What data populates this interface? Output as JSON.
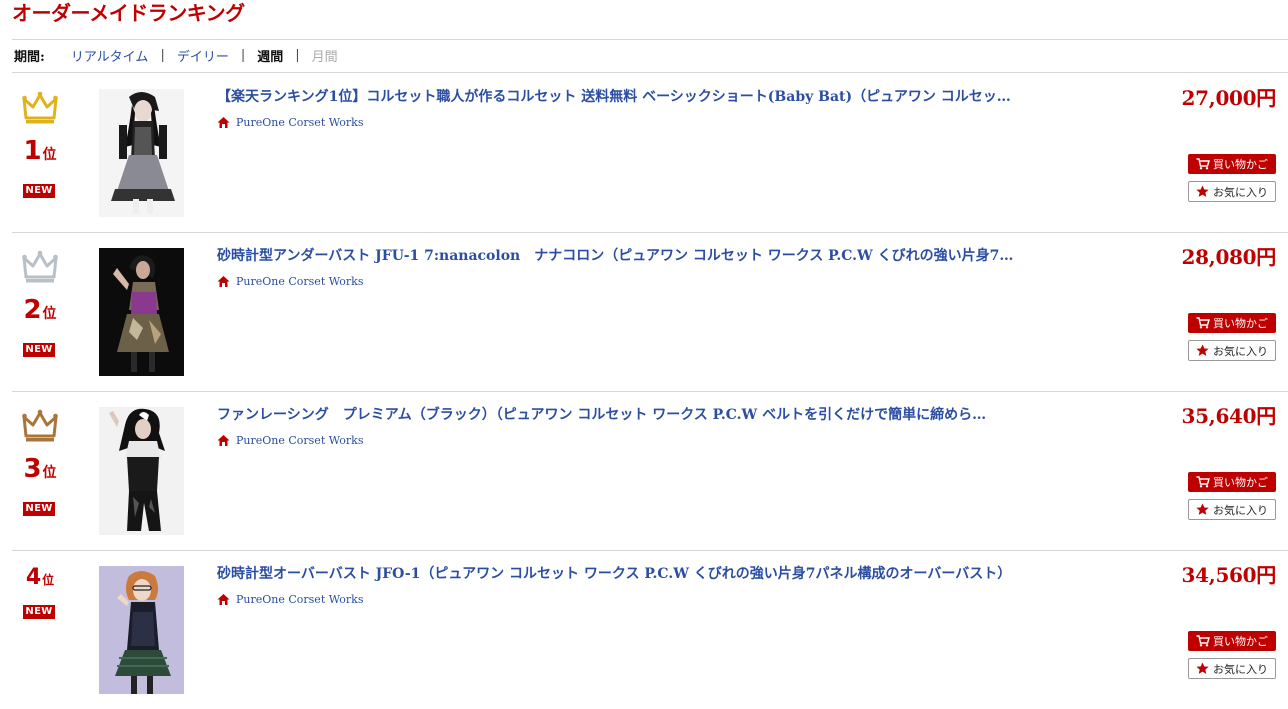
{
  "title": "オーダーメイドランキング",
  "period": {
    "label": "期間:",
    "options": [
      {
        "label": "リアルタイム",
        "state": "link"
      },
      {
        "label": "デイリー",
        "state": "link"
      },
      {
        "label": "週間",
        "state": "active"
      },
      {
        "label": "月間",
        "state": "disabled"
      }
    ],
    "separator": "|"
  },
  "colors": {
    "accent": "#bf0000",
    "link": "#2b4ea2",
    "crown_gold": "#e0b21e",
    "crown_silver": "#b7bfc7",
    "crown_bronze": "#a8753a"
  },
  "labels": {
    "new": "NEW",
    "rank_suffix": "位",
    "cart": "買い物かご",
    "favorite": "お気に入り"
  },
  "icons": {
    "shop": "house-icon",
    "cart": "cart-icon",
    "favorite": "star-icon",
    "rank": "crown-icon"
  },
  "items": [
    {
      "rank": "1",
      "crown": "gold",
      "name": "【楽天ランキング1位】コルセット職人が作るコルセット 送料無料 ベーシックショート(Baby Bat)（ピュアワン コルセッ…",
      "shop": "PureOne Corset Works",
      "price": "27,000円"
    },
    {
      "rank": "2",
      "crown": "silver",
      "name": "砂時計型アンダーバスト JFU-1 7:nanacolon　ナナコロン（ピュアワン コルセット ワークス P.C.W くびれの強い片身7パ…",
      "shop": "PureOne Corset Works",
      "price": "28,080円"
    },
    {
      "rank": "3",
      "crown": "bronze",
      "name": "ファンレーシング　プレミアム（ブラック）（ピュアワン コルセット ワークス P.C.W ベルトを引くだけで簡単に締めら…",
      "shop": "PureOne Corset Works",
      "price": "35,640円"
    },
    {
      "rank": "4",
      "crown": "none",
      "name": "砂時計型オーバーバスト JFO-1（ピュアワン コルセット ワークス P.C.W くびれの強い片身7パネル構成のオーバーバスト）",
      "shop": "PureOne Corset Works",
      "price": "34,560円"
    }
  ]
}
